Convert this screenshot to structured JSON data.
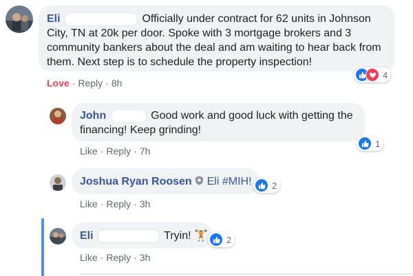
{
  "comments": [
    {
      "author": "Eli",
      "text": "Officially under contract for 62 units in Johnson City, TN at 20k per door. Spoke with 3 mortgage brokers and 3 community bankers about the deal and am waiting to hear back from them. Next step is to schedule the property inspection!",
      "reaction_action": "Love",
      "reply_label": "Reply",
      "time": "8h",
      "reaction_count": "4",
      "reaction_icons": [
        "like-icon",
        "love-icon"
      ]
    },
    {
      "author": "John",
      "text": "Good work and good luck with getting the financing! Keep grinding!",
      "reaction_action": "Like",
      "reply_label": "Reply",
      "time": "7h",
      "reaction_count": "1",
      "reaction_icons": [
        "like-icon"
      ]
    },
    {
      "author": "Joshua Ryan Roosen",
      "mention": "Eli",
      "hashtag": "#MIH!",
      "reaction_action": "Like",
      "reply_label": "Reply",
      "time": "3h",
      "reaction_count": "2",
      "reaction_icons": [
        "like-icon"
      ]
    },
    {
      "author": "Eli",
      "text": "Tryin!",
      "emoji": "🏋",
      "reaction_action": "Like",
      "reply_label": "Reply",
      "time": "3h",
      "reaction_count": "2",
      "reaction_icons": [
        "like-icon"
      ]
    }
  ],
  "colors": {
    "name": "#385898",
    "bubble": "#f0f2f5",
    "love": "#f33e58",
    "like": "#1877f2",
    "thread_line": "#4f8ef2"
  }
}
